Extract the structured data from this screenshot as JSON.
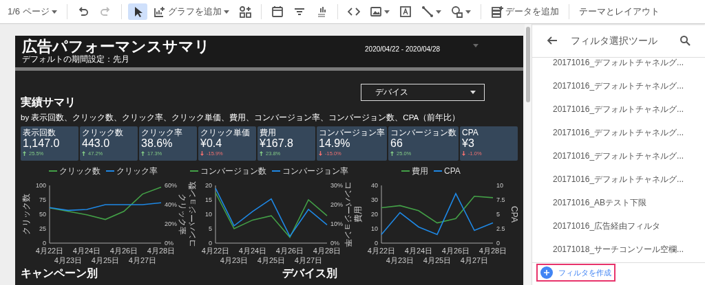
{
  "toolbar": {
    "page": "1/6 ページ",
    "undo": {
      "disabled": false
    },
    "redo": {
      "disabled": true
    },
    "tool_groups": [
      [
        {
          "kind": "select",
          "selected": true,
          "dropdown": false
        },
        {
          "kind": "add-chart",
          "label": "グラフを追加",
          "selected": false,
          "dropdown": true
        },
        {
          "kind": "components",
          "selected": false,
          "dropdown": false
        }
      ],
      [
        {
          "kind": "calendar",
          "selected": false,
          "dropdown": false
        },
        {
          "kind": "filter",
          "selected": false,
          "dropdown": false
        },
        {
          "kind": "data-control",
          "selected": false,
          "dropdown": false
        }
      ],
      [
        {
          "kind": "code",
          "selected": false,
          "dropdown": false
        },
        {
          "kind": "image",
          "selected": false,
          "dropdown": true
        },
        {
          "kind": "text",
          "selected": false,
          "dropdown": false
        },
        {
          "kind": "line",
          "selected": false,
          "dropdown": true
        },
        {
          "kind": "shape",
          "selected": false,
          "dropdown": true
        }
      ],
      [
        {
          "kind": "add-data",
          "label": "データを追加",
          "selected": false,
          "dropdown": false
        }
      ],
      [
        {
          "kind": "theme",
          "label": "テーマとレイアウト",
          "selected": false,
          "dropdown": false
        }
      ]
    ]
  },
  "report": {
    "title": "広告パフォーマンスサマリ",
    "subtitle": "デフォルトの期間設定：先月",
    "date_range": "2020/04/22 - 2020/04/28",
    "device_dropdown": "デバイス",
    "summary": {
      "heading": "実績サマリ",
      "description": "by 表示回数、クリック数、クリック率、クリック単価、費用、コンバージョン率、コンバージョン数、CPA（前年比）",
      "scorecards": [
        {
          "label": "表示回数",
          "value": "1,147.0",
          "delta": "25.5%",
          "rising": true
        },
        {
          "label": "クリック数",
          "value": "443.0",
          "delta": "47.2%",
          "rising": true
        },
        {
          "label": "クリック率",
          "value": "38.6%",
          "delta": "17.3%",
          "rising": true
        },
        {
          "label": "クリック単価",
          "value": "¥0.4",
          "delta": "-15.9%",
          "rising": false
        },
        {
          "label": "費用",
          "value": "¥167.8",
          "delta": "23.8%",
          "rising": true
        },
        {
          "label": "コンバージョン率",
          "value": "14.9%",
          "delta": "-15.0%",
          "rising": false
        },
        {
          "label": "コンバージョン数",
          "value": "66",
          "delta": "25.0%",
          "rising": true
        },
        {
          "label": "CPA",
          "value": "¥3",
          "delta": "-1.0%",
          "rising": false
        }
      ]
    },
    "charts": [
      {
        "chart_data": {
          "type": "line",
          "categories": [
            "4月22日",
            "4月23日",
            "4月24日",
            "4月25日",
            "4月26日",
            "4月27日",
            "4月28日"
          ],
          "legend": "top",
          "ylabel": "クリック数",
          "y2label": "クリック率",
          "ylim": [
            0,
            100
          ],
          "y2lim": [
            0,
            60
          ],
          "yticks": [
            0,
            25,
            50,
            75,
            100
          ],
          "y2ticks": [
            {
              "value": 0,
              "label": "0%"
            },
            {
              "value": 20,
              "label": "20%"
            },
            {
              "value": 40,
              "label": "40%"
            },
            {
              "value": 60,
              "label": "60%"
            }
          ],
          "series": [
            {
              "name": "クリック数",
              "color": "#43a047",
              "values": [
                61,
                55,
                49,
                41,
                55,
                85,
                97
              ]
            },
            {
              "name": "クリック率",
              "color": "#1e88e5",
              "axis": "y2",
              "values": [
                37,
                34,
                35,
                40,
                40,
                40,
                42
              ]
            }
          ]
        }
      },
      {
        "chart_data": {
          "type": "line",
          "categories": [
            "4月22日",
            "4月23日",
            "4月24日",
            "4月25日",
            "4月26日",
            "4月27日",
            "4月28日"
          ],
          "legend": "top",
          "ylabel": "コンバージョン数",
          "y2label": "コンバージョン率",
          "ylim": [
            0,
            20
          ],
          "y2lim": [
            0,
            30
          ],
          "yticks": [
            0,
            5,
            10,
            15,
            20
          ],
          "y2ticks": [
            {
              "value": 0,
              "label": "0%"
            },
            {
              "value": 10,
              "label": "10%"
            },
            {
              "value": 20,
              "label": "20%"
            },
            {
              "value": 30,
              "label": "30%"
            }
          ],
          "series": [
            {
              "name": "コンバージョン数",
              "color": "#43a047",
              "values": [
                17.5,
                5,
                8,
                9.5,
                2,
                15,
                9.5
              ]
            },
            {
              "name": "コンバージョン率",
              "color": "#1e88e5",
              "axis": "y2",
              "values": [
                28.5,
                9,
                16.5,
                23,
                3.5,
                17.5,
                9.5
              ]
            }
          ]
        }
      },
      {
        "chart_data": {
          "type": "line",
          "categories": [
            "4月22日",
            "4月23日",
            "4月24日",
            "4月25日",
            "4月26日",
            "4月27日",
            "4月28日"
          ],
          "legend": "top",
          "ylabel": "費用",
          "y2label": "CPA",
          "ylim": [
            0,
            40
          ],
          "y2lim": [
            0,
            10
          ],
          "yticks": [
            0,
            10,
            20,
            30,
            40
          ],
          "y2ticks": [
            0,
            2.5,
            5,
            7.5,
            10
          ],
          "series": [
            {
              "name": "費用",
              "color": "#43a047",
              "values": [
                24.5,
                26,
                22.5,
                14,
                17,
                32.5,
                31.5
              ]
            },
            {
              "name": "CPA",
              "color": "#1e88e5",
              "axis": "y2",
              "values": [
                1.5,
                5.3,
                2.8,
                1.5,
                8.6,
                2.2,
                3.5
              ]
            }
          ]
        }
      }
    ],
    "sections": [
      "キャンペーン別",
      "デバイス別"
    ]
  },
  "filter_panel": {
    "title": "フィルタ選択ツール",
    "items": [
      "20171016_デフォルトチャネルグ...",
      "20171016_デフォルトチャネルグ...",
      "20171016_デフォルトチャネルグ...",
      "20171016_デフォルトチャネルグ...",
      "20171016_デフォルトチャネルグ...",
      "20171016_デフォルトチャネルグ...",
      "20171016_ABテスト下限",
      "20171016_広告経由フィルタ",
      "20171018_サーチコンソール空欄..."
    ],
    "create_button": {
      "label": "フィルタを作成",
      "highlighted": true
    }
  }
}
